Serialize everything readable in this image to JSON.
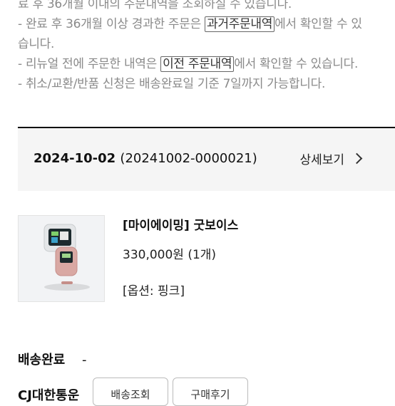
{
  "notice": {
    "line1": "료 후 36개월 이내의 주문내역을 조회하실 수 있습니다.",
    "line2_pre": "- 완료 후 36개월 이상 경과한 주문은 ",
    "line2_hl": "과거주문내역",
    "line2_post": "에서 확인할 수 있",
    "line3": "습니다.",
    "line4_pre": "- 리뉴얼 전에 주문한 내역은 ",
    "line4_hl": "이전 주문내역",
    "line4_post": "에서 확인할 수 있습니다.",
    "line5": "- 취소/교환/반품 신청은 배송완료일 기준 7일까지 가능합니다."
  },
  "order": {
    "date": "2024-10-02",
    "number": "(20241002-0000021)",
    "detail_label": "상세보기"
  },
  "product": {
    "name": "[마이에이밍] 굿보이스",
    "price": "330,000원 (1개)",
    "option": "[옵션: 핑크]",
    "thumbnail_icon": "product-image"
  },
  "delivery": {
    "status": "배송완료",
    "status_extra": "-",
    "courier": "CJ대한통운",
    "track_button": "배송조회",
    "review_button": "구매후기"
  }
}
